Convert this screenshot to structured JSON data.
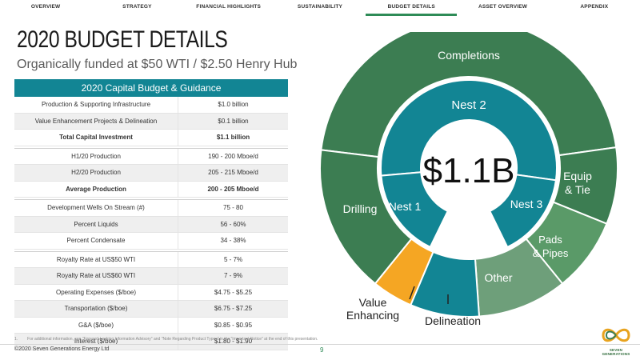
{
  "nav": {
    "items": [
      "OVERVIEW",
      "STRATEGY",
      "FINANCIAL HIGHLIGHTS",
      "SUSTAINABILITY",
      "BUDGET DETAILS",
      "ASSET OVERVIEW",
      "APPENDIX"
    ],
    "active_index": 4,
    "accent_color": "#2e8b57"
  },
  "page": {
    "title": "2020 BUDGET DETAILS",
    "subtitle": "Organically funded at $50 WTI / $2.50 Henry Hub"
  },
  "table": {
    "header": "2020 Capital Budget & Guidance",
    "header_color": "#128594",
    "groups": [
      [
        {
          "label": "Production & Supporting Infrastructure",
          "value": "$1.0 billion"
        },
        {
          "label": "Value Enhancement Projects & Delineation",
          "value": "$0.1 billion"
        },
        {
          "label": "Total Capital Investment",
          "value": "$1.1 billion",
          "total": true
        }
      ],
      [
        {
          "label": "H1/20 Production",
          "value": "190 - 200 Mboe/d"
        },
        {
          "label": "H2/20 Production",
          "value": "205 - 215 Mboe/d"
        },
        {
          "label": "Average Production",
          "value": "200 - 205 Mboe/d",
          "total": true
        }
      ],
      [
        {
          "label": "Development Wells On Stream (#)",
          "value": "75 - 80"
        },
        {
          "label": "Percent Liquids",
          "value": "56 - 60%"
        },
        {
          "label": "Percent Condensate",
          "value": "34 - 38%"
        }
      ],
      [
        {
          "label": "Royalty Rate at US$50 WTI",
          "value": "5 - 7%"
        },
        {
          "label": "Royalty Rate at US$60 WTI",
          "value": "7 - 9%"
        },
        {
          "label": "Operating Expenses ($/boe)",
          "value": "$4.75 - $5.25"
        },
        {
          "label": "Transportation ($/boe)",
          "value": "$6.75 - $7.25"
        },
        {
          "label": "G&A ($/boe)",
          "value": "$0.85 - $0.95"
        },
        {
          "label": "Interest ($/boe)",
          "value": "$1.80 - $1.90"
        }
      ]
    ]
  },
  "chart_data": {
    "type": "pie",
    "center_label": "$1.1B",
    "inner_ring": [
      {
        "name": "Nest 2",
        "color": "#128594"
      },
      {
        "name": "Nest 3",
        "color": "#128594"
      },
      {
        "name": "Nest 1",
        "color": "#128594"
      }
    ],
    "outer_ring": [
      {
        "name": "Completions",
        "color": "#3c7d52"
      },
      {
        "name": "Equip & Tie",
        "color": "#3c7d52"
      },
      {
        "name": "Pads & Pipes",
        "color": "#5a9a68"
      },
      {
        "name": "Other",
        "color": "#6e9f7a"
      },
      {
        "name": "Delineation",
        "color": "#128594"
      },
      {
        "name": "Value Enhancing",
        "color": "#f5a623"
      },
      {
        "name": "Drilling",
        "color": "#3c7d52"
      }
    ]
  },
  "footer": {
    "footnote_number": "1.",
    "footnote": "For additional information, see \"Forward-Looking Information Advisory\" and \"Note Regarding Product Types\" in the \"Important Notice\" at the end of this presentation.",
    "copyright": "©2020 Seven Generations Energy Ltd",
    "page_number": "9",
    "logo_text": "SEVEN GENERATIONS"
  }
}
